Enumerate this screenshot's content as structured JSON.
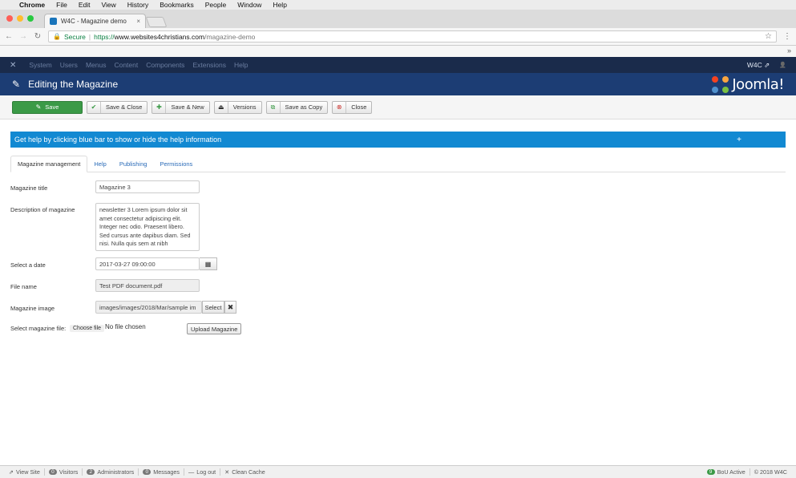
{
  "mac_menu": {
    "apple": "",
    "app": "Chrome",
    "items": [
      "File",
      "Edit",
      "View",
      "History",
      "Bookmarks",
      "People",
      "Window",
      "Help"
    ]
  },
  "browser": {
    "traffic_colors": [
      "#ff5f57",
      "#ffbd2e",
      "#28c940"
    ],
    "tab_title": "W4C - Magazine demo",
    "tab_close": "×",
    "secure_label": "Secure",
    "separator": "|",
    "url_scheme": "https://",
    "url_host": "www.websites4christians.com",
    "url_path": "/magazine-demo",
    "star": "☆",
    "menu": "⋮",
    "bookmarks_chevron": "»"
  },
  "joomla_nav": {
    "logo": "✕",
    "items": [
      "System",
      "Users",
      "Menus",
      "Content",
      "Components",
      "Extensions",
      "Help"
    ],
    "site_link": "W4C ⇗",
    "user_icon": "👤"
  },
  "header": {
    "pencil": "✎",
    "title": "Editing the Magazine",
    "brand": "Joomla!"
  },
  "toolbar": {
    "save": "Save",
    "save_close": "Save & Close",
    "save_new": "Save & New",
    "versions": "Versions",
    "save_copy": "Save as Copy",
    "close": "Close"
  },
  "help_bar": {
    "text": "Get help by clicking blue bar to show or hide the help information",
    "plus": "+"
  },
  "tabs": [
    "Magazine management",
    "Help",
    "Publishing",
    "Permissions"
  ],
  "form": {
    "title_label": "Magazine title",
    "title_value": "Magazine 3",
    "desc_label": "Description of magazine",
    "desc_value": " newsletter 3 Lorem ipsum dolor sit amet consectetur adipiscing elit. Integer nec odio. Praesent libero. Sed cursus ante dapibus diam. Sed nisi. Nulla quis sem at nibh",
    "date_label": "Select a date",
    "date_value": "2017-03-27 09:00:00",
    "file_label": "File name",
    "file_value": "Test PDF document.pdf",
    "image_label": "Magazine image",
    "image_value": "images/images/2018/Mar/sample im",
    "select_btn": "Select",
    "clear_btn": "✖",
    "upload_label": "Select magazine file:",
    "choose_file": "Choose file",
    "no_file": "No file chosen",
    "upload_btn": "Upload Magazine"
  },
  "status_bar": {
    "view_site": "View Site",
    "visitors_count": "0",
    "visitors": "Visitors",
    "admins_count": "2",
    "admins": "Administrators",
    "messages_count": "0",
    "messages": "Messages",
    "logout": "Log out",
    "clean_cache": "Clean Cache",
    "bou_count": "9",
    "bou": "BoU Active",
    "copyright": "© 2018 W4C"
  }
}
